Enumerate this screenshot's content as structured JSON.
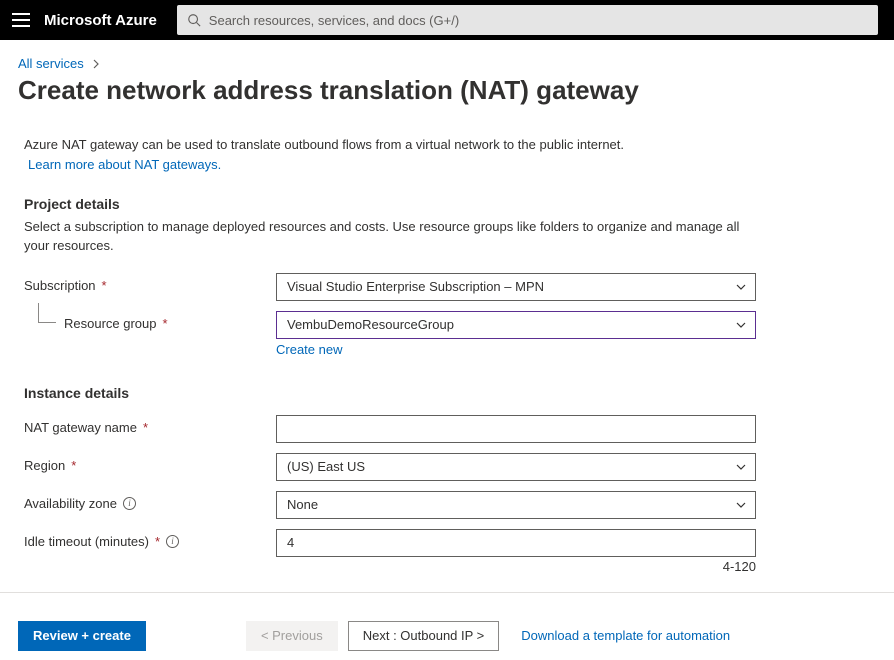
{
  "header": {
    "brand": "Microsoft Azure",
    "search_placeholder": "Search resources, services, and docs (G+/)"
  },
  "breadcrumb": {
    "link": "All services"
  },
  "page": {
    "title": "Create network address translation (NAT) gateway",
    "intro": "Azure NAT gateway can be used to translate outbound flows from a virtual network to the public internet.",
    "learn_more": "Learn more about NAT gateways."
  },
  "sections": {
    "project": {
      "title": "Project details",
      "description": "Select a subscription to manage deployed resources and costs. Use resource groups like folders to organize and manage all your resources.",
      "subscription_label": "Subscription",
      "subscription_value": "Visual Studio Enterprise Subscription – MPN",
      "resource_group_label": "Resource group",
      "resource_group_value": "VembuDemoResourceGroup",
      "create_new": "Create new"
    },
    "instance": {
      "title": "Instance details",
      "name_label": "NAT gateway name",
      "name_value": "",
      "region_label": "Region",
      "region_value": "(US) East US",
      "az_label": "Availability zone",
      "az_value": "None",
      "idle_label": "Idle timeout (minutes)",
      "idle_value": "4",
      "idle_hint": "4-120"
    }
  },
  "footer": {
    "review": "Review + create",
    "previous": "< Previous",
    "next": "Next : Outbound IP >",
    "template_link": "Download a template for automation"
  }
}
